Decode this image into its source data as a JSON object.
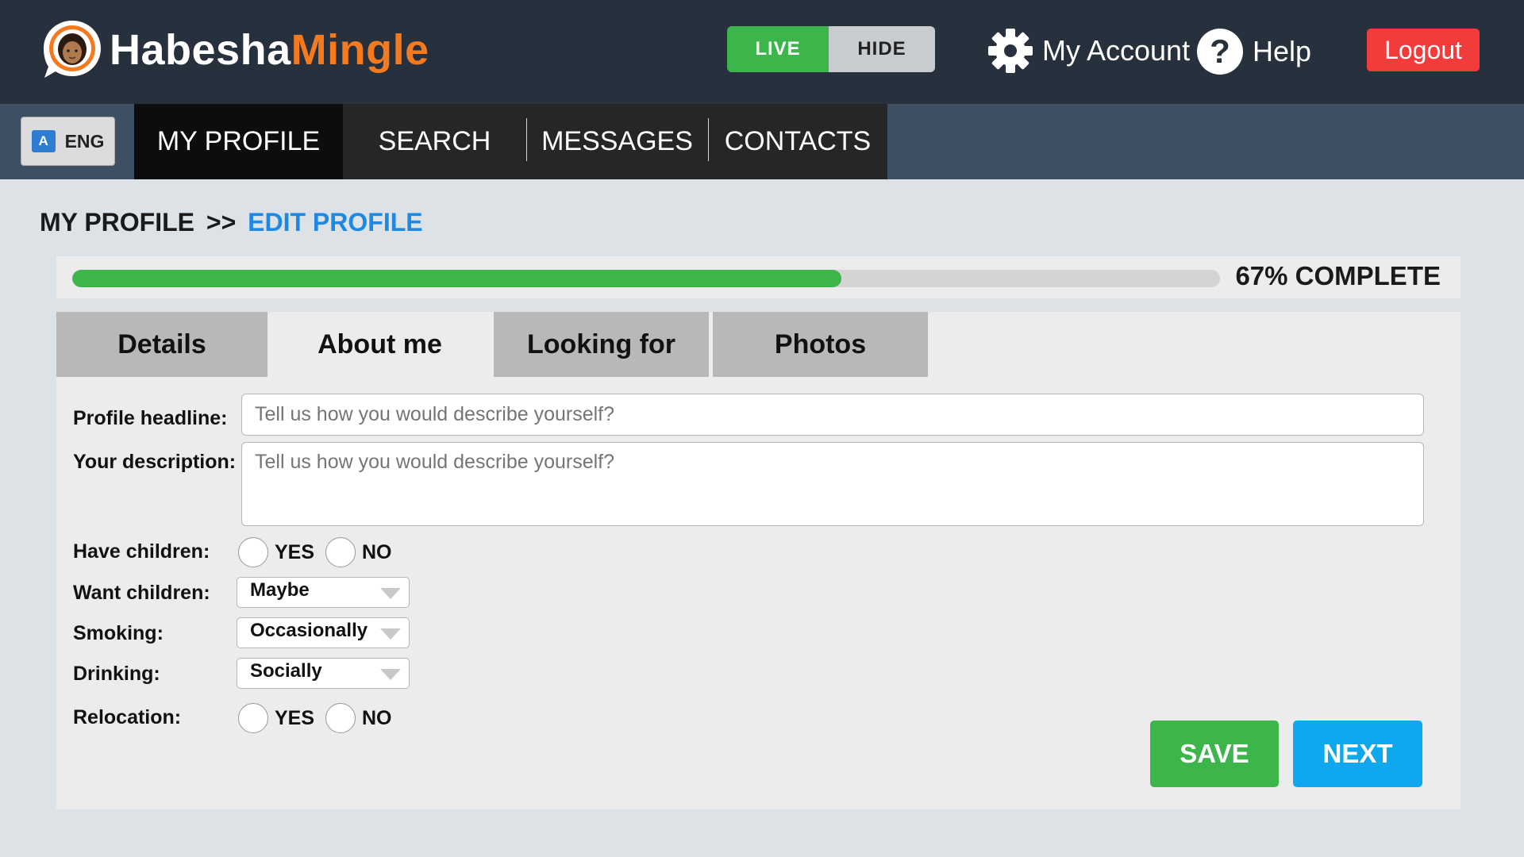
{
  "header": {
    "brand_part1": "Habesha",
    "brand_part2": "Mingle",
    "toggle_live": "LIVE",
    "toggle_hide": "HIDE",
    "my_account": "My Account",
    "help": "Help",
    "help_glyph": "?",
    "logout": "Logout",
    "icons": {
      "logo": "chat-bubble-avatar-icon",
      "account": "gear-icon",
      "help": "question-icon"
    }
  },
  "nav": {
    "language": "ENG",
    "language_icon": "translate-icon",
    "tabs": [
      "MY PROFILE",
      "SEARCH",
      "MESSAGES",
      "CONTACTS"
    ],
    "active_tab": "MY PROFILE"
  },
  "breadcrumb": {
    "parent": "MY PROFILE",
    "separator": ">>",
    "current": "EDIT PROFILE"
  },
  "progress": {
    "percent": 67,
    "label": "67% COMPLETE"
  },
  "form": {
    "tabs": [
      "Details",
      "About me",
      "Looking for",
      "Photos"
    ],
    "active_tab": "About me",
    "profile_headline": {
      "label": "Profile headline:",
      "placeholder": "Tell us how you would describe yourself?"
    },
    "description": {
      "label": "Your description:",
      "placeholder": "Tell us how you would describe yourself?"
    },
    "have_children": {
      "label": "Have children:",
      "yes": "YES",
      "no": "NO"
    },
    "want_children": {
      "label": "Want children:",
      "value": "Maybe"
    },
    "smoking": {
      "label": "Smoking:",
      "value": "Occasionally"
    },
    "drinking": {
      "label": "Drinking:",
      "value": "Socially"
    },
    "relocation": {
      "label": "Relocation:",
      "yes": "YES",
      "no": "NO"
    },
    "save": "SAVE",
    "next": "NEXT"
  },
  "colors": {
    "header_bg": "#27313d",
    "nav_bg": "#3e4f63",
    "accent_green": "#3cb54a",
    "accent_blue": "#0fa8ee",
    "link_blue": "#1e88e5",
    "logout_red": "#f23b3b",
    "brand_orange": "#f47a20"
  }
}
